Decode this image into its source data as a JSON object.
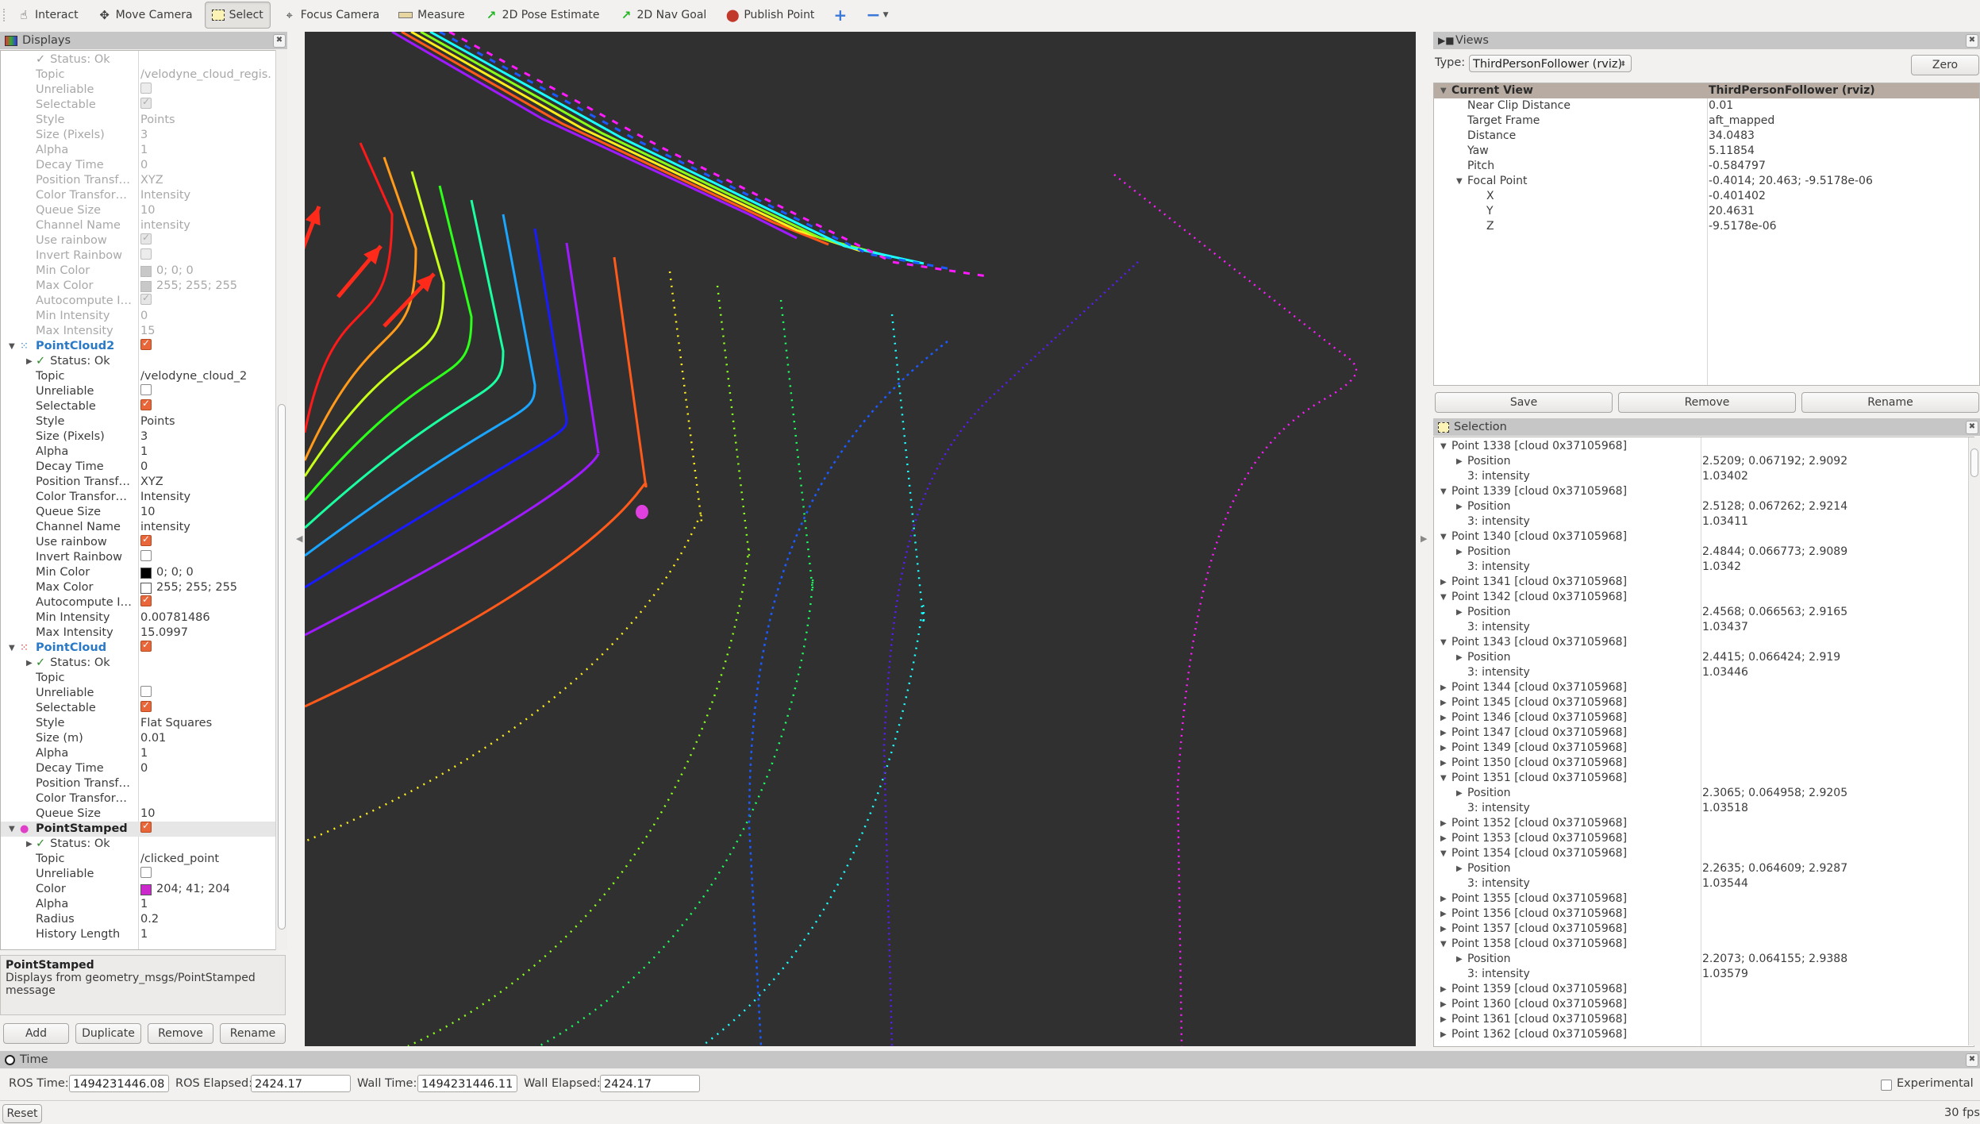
{
  "toolbar": {
    "tools": [
      {
        "label": "Interact",
        "icon": "hand-pointer-icon"
      },
      {
        "label": "Move Camera",
        "icon": "move-camera-icon"
      },
      {
        "label": "Select",
        "icon": "select-rectangle-icon",
        "active": true
      },
      {
        "label": "Focus Camera",
        "icon": "crosshair-icon"
      },
      {
        "label": "Measure",
        "icon": "ruler-icon"
      },
      {
        "label": "2D Pose Estimate",
        "icon": "green-arrow-icon"
      },
      {
        "label": "2D Nav Goal",
        "icon": "green-arrow-icon"
      },
      {
        "label": "Publish Point",
        "icon": "map-pin-icon"
      }
    ],
    "add_tool": "+",
    "remove_tool": "−"
  },
  "displays": {
    "title": "Displays",
    "rows": [
      {
        "kind": "status",
        "label": "Status: Ok",
        "disabled": true
      },
      {
        "kind": "prop",
        "label": "Topic",
        "value": "/velodyne_cloud_regis...",
        "disabled": true
      },
      {
        "kind": "check",
        "label": "Unreliable",
        "checked": false,
        "disabled": true
      },
      {
        "kind": "check",
        "label": "Selectable",
        "checked": true,
        "disabled": true
      },
      {
        "kind": "prop",
        "label": "Style",
        "value": "Points",
        "disabled": true
      },
      {
        "kind": "prop",
        "label": "Size (Pixels)",
        "value": "3",
        "disabled": true
      },
      {
        "kind": "prop",
        "label": "Alpha",
        "value": "1",
        "disabled": true
      },
      {
        "kind": "prop",
        "label": "Decay Time",
        "value": "0",
        "disabled": true
      },
      {
        "kind": "prop",
        "label": "Position Transfo...",
        "value": "XYZ",
        "disabled": true
      },
      {
        "kind": "prop",
        "label": "Color Transformer",
        "value": "Intensity",
        "disabled": true
      },
      {
        "kind": "prop",
        "label": "Queue Size",
        "value": "10",
        "disabled": true
      },
      {
        "kind": "prop",
        "label": "Channel Name",
        "value": "intensity",
        "disabled": true
      },
      {
        "kind": "check",
        "label": "Use rainbow",
        "checked": true,
        "disabled": true
      },
      {
        "kind": "check",
        "label": "Invert Rainbow",
        "checked": false,
        "disabled": true
      },
      {
        "kind": "color",
        "label": "Min Color",
        "value": "0; 0; 0",
        "swatch": "#c8c8c8",
        "disabled": true
      },
      {
        "kind": "color",
        "label": "Max Color",
        "value": "255; 255; 255",
        "swatch": "#c8c8c8",
        "disabled": true
      },
      {
        "kind": "check",
        "label": "Autocompute In...",
        "checked": true,
        "disabled": true
      },
      {
        "kind": "prop",
        "label": "Min Intensity",
        "value": "0",
        "disabled": true
      },
      {
        "kind": "prop",
        "label": "Max Intensity",
        "value": "15",
        "disabled": true
      },
      {
        "kind": "group",
        "label": "PointCloud2",
        "checked": true,
        "icon": "pointcloud2-icon",
        "icon_color": "#2a7ac7"
      },
      {
        "kind": "status",
        "label": "Status: Ok"
      },
      {
        "kind": "prop",
        "label": "Topic",
        "value": "/velodyne_cloud_2"
      },
      {
        "kind": "check",
        "label": "Unreliable",
        "checked": false
      },
      {
        "kind": "check",
        "label": "Selectable",
        "checked": true
      },
      {
        "kind": "prop",
        "label": "Style",
        "value": "Points"
      },
      {
        "kind": "prop",
        "label": "Size (Pixels)",
        "value": "3"
      },
      {
        "kind": "prop",
        "label": "Alpha",
        "value": "1"
      },
      {
        "kind": "prop",
        "label": "Decay Time",
        "value": "0"
      },
      {
        "kind": "prop",
        "label": "Position Transfo...",
        "value": "XYZ"
      },
      {
        "kind": "prop",
        "label": "Color Transformer",
        "value": "Intensity"
      },
      {
        "kind": "prop",
        "label": "Queue Size",
        "value": "10"
      },
      {
        "kind": "prop",
        "label": "Channel Name",
        "value": "intensity"
      },
      {
        "kind": "check",
        "label": "Use rainbow",
        "checked": true
      },
      {
        "kind": "check",
        "label": "Invert Rainbow",
        "checked": false
      },
      {
        "kind": "color",
        "label": "Min Color",
        "value": "0; 0; 0",
        "swatch": "#000000"
      },
      {
        "kind": "color",
        "label": "Max Color",
        "value": "255; 255; 255",
        "swatch": "#ffffff"
      },
      {
        "kind": "check",
        "label": "Autocompute In...",
        "checked": true
      },
      {
        "kind": "prop",
        "label": "Min Intensity",
        "value": "0.00781486"
      },
      {
        "kind": "prop",
        "label": "Max Intensity",
        "value": "15.0997"
      },
      {
        "kind": "group",
        "label": "PointCloud",
        "checked": true,
        "icon": "pointcloud-icon",
        "icon_color": "#d42020"
      },
      {
        "kind": "status",
        "label": "Status: Ok"
      },
      {
        "kind": "prop",
        "label": "Topic",
        "value": ""
      },
      {
        "kind": "check",
        "label": "Unreliable",
        "checked": false
      },
      {
        "kind": "check",
        "label": "Selectable",
        "checked": true
      },
      {
        "kind": "prop",
        "label": "Style",
        "value": "Flat Squares"
      },
      {
        "kind": "prop",
        "label": "Size (m)",
        "value": "0.01"
      },
      {
        "kind": "prop",
        "label": "Alpha",
        "value": "1"
      },
      {
        "kind": "prop",
        "label": "Decay Time",
        "value": "0"
      },
      {
        "kind": "prop",
        "label": "Position Transfo...",
        "value": ""
      },
      {
        "kind": "prop",
        "label": "Color Transformer",
        "value": ""
      },
      {
        "kind": "prop",
        "label": "Queue Size",
        "value": "10"
      },
      {
        "kind": "group",
        "label": "PointStamped",
        "checked": true,
        "icon": "point-stamped-icon",
        "icon_color": "#e040c8",
        "selected": true
      },
      {
        "kind": "status",
        "label": "Status: Ok"
      },
      {
        "kind": "prop",
        "label": "Topic",
        "value": "/clicked_point"
      },
      {
        "kind": "check",
        "label": "Unreliable",
        "checked": false
      },
      {
        "kind": "color",
        "label": "Color",
        "value": "204; 41; 204",
        "swatch": "#cc29cc"
      },
      {
        "kind": "prop",
        "label": "Alpha",
        "value": "1"
      },
      {
        "kind": "prop",
        "label": "Radius",
        "value": "0.2"
      },
      {
        "kind": "prop",
        "label": "History Length",
        "value": "1"
      }
    ],
    "description_title": "PointStamped",
    "description_text": "Displays from geometry_msgs/PointStamped message",
    "buttons": {
      "add": "Add",
      "duplicate": "Duplicate",
      "remove": "Remove",
      "rename": "Rename"
    }
  },
  "views": {
    "title": "Views",
    "type_label": "Type:",
    "type_value": "ThirdPersonFollower (rviz)",
    "zero_label": "Zero",
    "header": {
      "label": "Current View",
      "value": "ThirdPersonFollower (rviz)"
    },
    "rows": [
      {
        "label": "Near Clip Distance",
        "value": "0.01",
        "level": 1
      },
      {
        "label": "Target Frame",
        "value": "aft_mapped",
        "level": 1
      },
      {
        "label": "Distance",
        "value": "34.0483",
        "level": 1
      },
      {
        "label": "Yaw",
        "value": "5.11854",
        "level": 1
      },
      {
        "label": "Pitch",
        "value": "-0.584797",
        "level": 1
      },
      {
        "label": "Focal Point",
        "value": "-0.4014; 20.463; -9.5178e-06",
        "level": 1,
        "expanded": true
      },
      {
        "label": "X",
        "value": "-0.401402",
        "level": 2
      },
      {
        "label": "Y",
        "value": "20.4631",
        "level": 2
      },
      {
        "label": "Z",
        "value": "-9.5178e-06",
        "level": 2
      }
    ],
    "buttons": {
      "save": "Save",
      "remove": "Remove",
      "rename": "Rename"
    }
  },
  "selection": {
    "title": "Selection",
    "rows": [
      {
        "type": "point",
        "label": "Point 1338 [cloud 0x37105968]",
        "expanded": true
      },
      {
        "type": "pos",
        "label": "Position",
        "value": "2.5209; 0.067192; 2.9092"
      },
      {
        "type": "int",
        "label": "3: intensity",
        "value": "1.03402"
      },
      {
        "type": "point",
        "label": "Point 1339 [cloud 0x37105968]",
        "expanded": true
      },
      {
        "type": "pos",
        "label": "Position",
        "value": "2.5128; 0.067262; 2.9214"
      },
      {
        "type": "int",
        "label": "3: intensity",
        "value": "1.03411"
      },
      {
        "type": "point",
        "label": "Point 1340 [cloud 0x37105968]",
        "expanded": true
      },
      {
        "type": "pos",
        "label": "Position",
        "value": "2.4844; 0.066773; 2.9089"
      },
      {
        "type": "int",
        "label": "3: intensity",
        "value": "1.0342"
      },
      {
        "type": "point",
        "label": "Point 1341 [cloud 0x37105968]",
        "expanded": false
      },
      {
        "type": "point",
        "label": "Point 1342 [cloud 0x37105968]",
        "expanded": true
      },
      {
        "type": "pos",
        "label": "Position",
        "value": "2.4568; 0.066563; 2.9165"
      },
      {
        "type": "int",
        "label": "3: intensity",
        "value": "1.03437"
      },
      {
        "type": "point",
        "label": "Point 1343 [cloud 0x37105968]",
        "expanded": true
      },
      {
        "type": "pos",
        "label": "Position",
        "value": "2.4415; 0.066424; 2.919"
      },
      {
        "type": "int",
        "label": "3: intensity",
        "value": "1.03446"
      },
      {
        "type": "point",
        "label": "Point 1344 [cloud 0x37105968]",
        "expanded": false
      },
      {
        "type": "point",
        "label": "Point 1345 [cloud 0x37105968]",
        "expanded": false
      },
      {
        "type": "point",
        "label": "Point 1346 [cloud 0x37105968]",
        "expanded": false
      },
      {
        "type": "point",
        "label": "Point 1347 [cloud 0x37105968]",
        "expanded": false
      },
      {
        "type": "point",
        "label": "Point 1349 [cloud 0x37105968]",
        "expanded": false
      },
      {
        "type": "point",
        "label": "Point 1350 [cloud 0x37105968]",
        "expanded": false
      },
      {
        "type": "point",
        "label": "Point 1351 [cloud 0x37105968]",
        "expanded": true
      },
      {
        "type": "pos",
        "label": "Position",
        "value": "2.3065; 0.064958; 2.9205"
      },
      {
        "type": "int",
        "label": "3: intensity",
        "value": "1.03518"
      },
      {
        "type": "point",
        "label": "Point 1352 [cloud 0x37105968]",
        "expanded": false
      },
      {
        "type": "point",
        "label": "Point 1353 [cloud 0x37105968]",
        "expanded": false
      },
      {
        "type": "point",
        "label": "Point 1354 [cloud 0x37105968]",
        "expanded": true
      },
      {
        "type": "pos",
        "label": "Position",
        "value": "2.2635; 0.064609; 2.9287"
      },
      {
        "type": "int",
        "label": "3: intensity",
        "value": "1.03544"
      },
      {
        "type": "point",
        "label": "Point 1355 [cloud 0x37105968]",
        "expanded": false
      },
      {
        "type": "point",
        "label": "Point 1356 [cloud 0x37105968]",
        "expanded": false
      },
      {
        "type": "point",
        "label": "Point 1357 [cloud 0x37105968]",
        "expanded": false
      },
      {
        "type": "point",
        "label": "Point 1358 [cloud 0x37105968]",
        "expanded": true
      },
      {
        "type": "pos",
        "label": "Position",
        "value": "2.2073; 0.064155; 2.9388"
      },
      {
        "type": "int",
        "label": "3: intensity",
        "value": "1.03579"
      },
      {
        "type": "point",
        "label": "Point 1359 [cloud 0x37105968]",
        "expanded": false
      },
      {
        "type": "point",
        "label": "Point 1360 [cloud 0x37105968]",
        "expanded": false
      },
      {
        "type": "point",
        "label": "Point 1361 [cloud 0x37105968]",
        "expanded": false
      },
      {
        "type": "point",
        "label": "Point 1362 [cloud 0x37105968]",
        "expanded": false
      }
    ]
  },
  "time": {
    "title": "Time",
    "ros_time_label": "ROS Time:",
    "ros_time": "1494231446.08",
    "ros_elapsed_label": "ROS Elapsed:",
    "ros_elapsed": "2424.17",
    "wall_time_label": "Wall Time:",
    "wall_time": "1494231446.11",
    "wall_elapsed_label": "Wall Elapsed:",
    "wall_elapsed": "2424.17",
    "experimental_label": "Experimental",
    "experimental_checked": false,
    "reset_label": "Reset",
    "fps": "30 fps"
  },
  "viewport": {
    "background": "#303030",
    "clicked_point_color": "#e040e0",
    "scan_colors": [
      "#ff1a1a",
      "#ff9a1a",
      "#c8ff1a",
      "#2dff1a",
      "#1affa0",
      "#1aa6ff",
      "#1a1aff",
      "#a01aff",
      "#ff5a1a",
      "#ffee1a",
      "#8aff1a",
      "#1aff60",
      "#1affff",
      "#1a5aff",
      "#5a1aff",
      "#ff1aff"
    ]
  }
}
